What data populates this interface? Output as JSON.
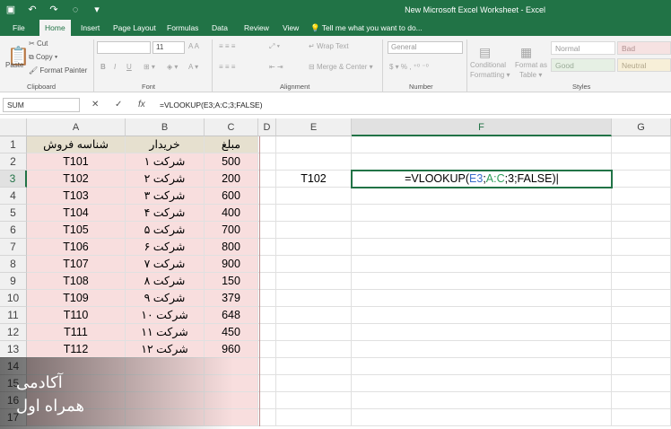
{
  "window": {
    "title": "New Microsoft Excel Worksheet - Excel"
  },
  "tabs": [
    "File",
    "Home",
    "Insert",
    "Page Layout",
    "Formulas",
    "Data",
    "Review",
    "View"
  ],
  "tell_me": "Tell me what you want to do...",
  "ribbon": {
    "clipboard": {
      "paste": "Paste",
      "cut": "Cut",
      "copy": "Copy",
      "format_painter": "Format Painter",
      "label": "Clipboard"
    },
    "font": {
      "size": "11",
      "bold": "B",
      "italic": "I",
      "underline": "U",
      "label": "Font"
    },
    "alignment": {
      "wrap_text": "Wrap Text",
      "merge_center": "Merge & Center",
      "label": "Alignment"
    },
    "number": {
      "format": "General",
      "label": "Number"
    },
    "styles_cmds": {
      "conditional": "Conditional",
      "formatting": "Formatting",
      "format_as": "Format as",
      "table": "Table",
      "label": "Styles"
    },
    "styles": {
      "normal": "Normal",
      "bad": "Bad",
      "good": "Good",
      "neutral": "Neutral"
    }
  },
  "formula_bar": {
    "name_box": "SUM",
    "fx": "fx",
    "formula": "=VLOOKUP(E3;A:C;3;FALSE)"
  },
  "columns": [
    "A",
    "B",
    "C",
    "D",
    "E",
    "F",
    "G"
  ],
  "rows": [
    "1",
    "2",
    "3",
    "4",
    "5",
    "6",
    "7",
    "8",
    "9",
    "10",
    "11",
    "12",
    "13",
    "14",
    "15",
    "16",
    "17"
  ],
  "table": {
    "headers": [
      "شناسه فروش",
      "خریدار",
      "مبلغ"
    ],
    "rows": [
      [
        "T101",
        "شرکت ۱",
        "500"
      ],
      [
        "T102",
        "شرکت ۲",
        "200"
      ],
      [
        "T103",
        "شرکت ۳",
        "600"
      ],
      [
        "T104",
        "شرکت ۴",
        "400"
      ],
      [
        "T105",
        "شرکت ۵",
        "700"
      ],
      [
        "T106",
        "شرکت ۶",
        "800"
      ],
      [
        "T107",
        "شرکت ۷",
        "900"
      ],
      [
        "T108",
        "شرکت ۸",
        "150"
      ],
      [
        "T109",
        "شرکت ۹",
        "379"
      ],
      [
        "T110",
        "شرکت ۱۰",
        "648"
      ],
      [
        "T111",
        "شرکت ۱۱",
        "450"
      ],
      [
        "T112",
        "شرکت ۱۲",
        "960"
      ]
    ]
  },
  "lookup": {
    "e3": "T102",
    "formula_parts": {
      "prefix": "=VLOOKUP(",
      "ref1": "E3",
      "sep1": ";",
      "ref2": "A:C",
      "rest": ";3;FALSE)"
    }
  },
  "watermark": {
    "line1": "آکادمی",
    "line2": "همراه اول"
  },
  "colors": {
    "excel_green": "#217346",
    "row_pink": "#f8dede",
    "header_beige": "#e6e0cf"
  }
}
